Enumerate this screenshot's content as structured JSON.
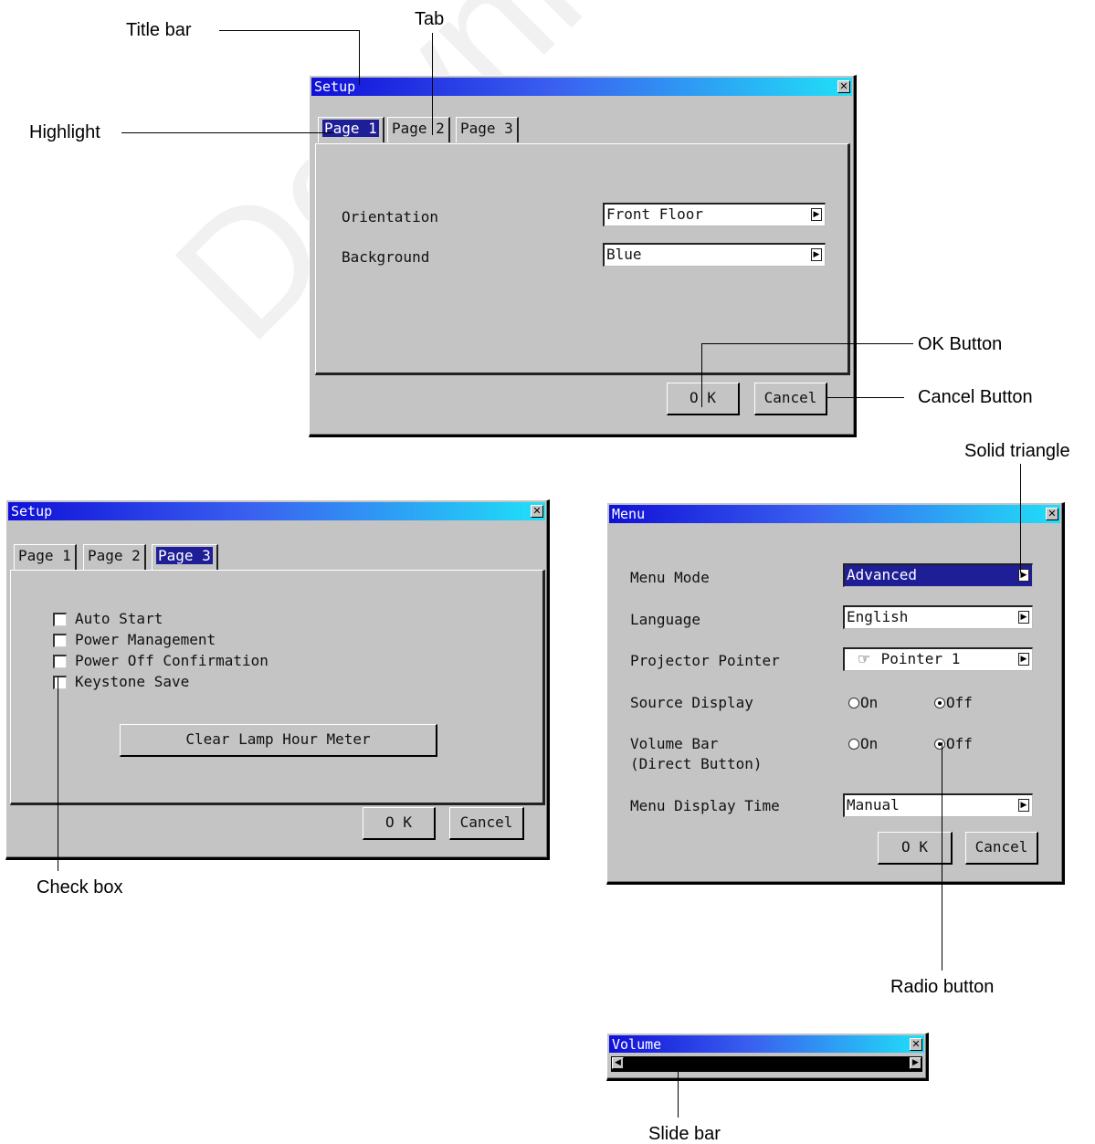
{
  "watermark": "Downloaded from www.Projector.com",
  "setup1": {
    "title": "Setup",
    "close_glyph": "✕",
    "tabs": [
      "Page 1",
      "Page 2",
      "Page 3"
    ],
    "fields": [
      {
        "label": "Orientation",
        "value": "Front Floor"
      },
      {
        "label": "Background",
        "value": "Blue"
      }
    ],
    "ok_label": "O K",
    "cancel_label": "Cancel"
  },
  "setup3": {
    "title": "Setup",
    "close_glyph": "✕",
    "tabs": [
      "Page 1",
      "Page 2",
      "Page 3"
    ],
    "checkboxes": [
      "Auto Start",
      "Power Management",
      "Power Off Confirmation",
      "Keystone Save"
    ],
    "clear_label": "Clear Lamp Hour Meter",
    "ok_label": "O K",
    "cancel_label": "Cancel"
  },
  "menu": {
    "title": "Menu",
    "close_glyph": "✕",
    "menu_mode": {
      "label": "Menu Mode",
      "value": "Advanced"
    },
    "language": {
      "label": "Language",
      "value": "English"
    },
    "pointer": {
      "label": "Projector Pointer",
      "value": "Pointer 1",
      "icon": "hand-pointer-icon"
    },
    "source_display": {
      "label": "Source Display",
      "on": "On",
      "off": "Off",
      "selected": "Off"
    },
    "volume_bar": {
      "label_line1": "Volume Bar",
      "label_line2": "(Direct Button)",
      "on": "On",
      "off": "Off",
      "selected": "Off"
    },
    "display_time": {
      "label": "Menu Display Time",
      "value": "Manual"
    },
    "ok_label": "O K",
    "cancel_label": "Cancel"
  },
  "volume": {
    "title": "Volume",
    "close_glyph": "✕",
    "left_glyph": "◀",
    "right_glyph": "▶"
  },
  "arrow_glyph": "▶",
  "annotations": {
    "title_bar": "Title bar",
    "tab": "Tab",
    "highlight": "Highlight",
    "ok_button": "OK Button",
    "cancel_button": "Cancel Button",
    "solid_triangle": "Solid triangle",
    "check_box": "Check box",
    "radio_button": "Radio button",
    "slide_bar": "Slide bar"
  },
  "colors": {
    "window_bg": "#c4c4c4",
    "titlebar_start": "#1010d8",
    "titlebar_end": "#20e0f8",
    "highlight": "#1e1e96"
  }
}
